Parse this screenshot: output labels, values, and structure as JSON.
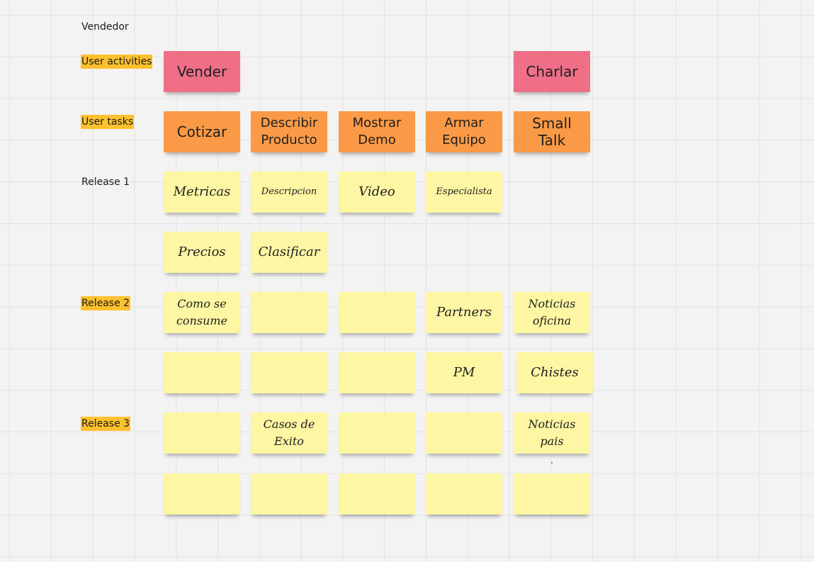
{
  "board": {
    "persona": "Vendedor",
    "rows": {
      "activities": "User activities",
      "tasks": "User tasks",
      "release1": "Release 1",
      "release2": "Release 2",
      "release3": "Release 3"
    },
    "activities": [
      "Vender",
      "Charlar"
    ],
    "tasks": [
      "Cotizar",
      "Describir\nProducto",
      "Mostrar\nDemo",
      "Armar\nEquipo",
      "Small Talk"
    ],
    "release1": {
      "row_a": [
        "Metricas",
        "Descripcion",
        "Video",
        "Especialista"
      ],
      "row_b": [
        "Precios",
        "Clasificar"
      ]
    },
    "release2": {
      "row_a": [
        "Como se\nconsume",
        "",
        "",
        "Partners",
        "Noticias\noficina"
      ],
      "row_b": [
        "",
        "",
        "",
        "PM",
        "Chistes"
      ]
    },
    "release3": {
      "row_a": [
        "",
        "Casos de\nExito",
        "",
        "",
        "Noticias\npais"
      ],
      "row_b": [
        "",
        "",
        "",
        "",
        ""
      ]
    },
    "colors": {
      "activity": "#ee6f86",
      "task": "#fa9a46",
      "story": "#fdf6a3",
      "label_highlight": "#fdc12e"
    }
  }
}
